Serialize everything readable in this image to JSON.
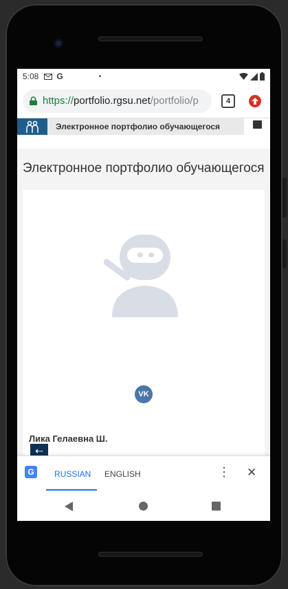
{
  "status_bar": {
    "time": "5:08",
    "google_letter": "G",
    "notification_dot": "•",
    "icons": [
      "gmail-icon",
      "wifi-icon",
      "signal-icon",
      "battery-icon"
    ]
  },
  "browser": {
    "url_scheme": "https://",
    "url_host": "portfolio.rgsu.net",
    "url_path": "/portfolio/p",
    "tab_count": "4",
    "update_icon": "arrow-up-icon"
  },
  "site": {
    "header_title": "Электронное портфолио обучающегося",
    "page_title": "Электронное портфолио обучающегося",
    "vk_label": "VK",
    "user_name": "Лика Гелаевна Ш.",
    "back_arrow": "⇠"
  },
  "translate_bar": {
    "source_lang": "RUSSIAN",
    "target_lang": "ENGLISH",
    "more_glyph": "⋮",
    "close_glyph": "✕",
    "logo_glyph": "G"
  },
  "colors": {
    "url_scheme": "#188038",
    "url_path": "#80868b",
    "selected_tab": "#1a73e8",
    "vk_blue": "#4a76a8",
    "site_blue": "#1f5e8c",
    "back_button": "#0f3057"
  }
}
